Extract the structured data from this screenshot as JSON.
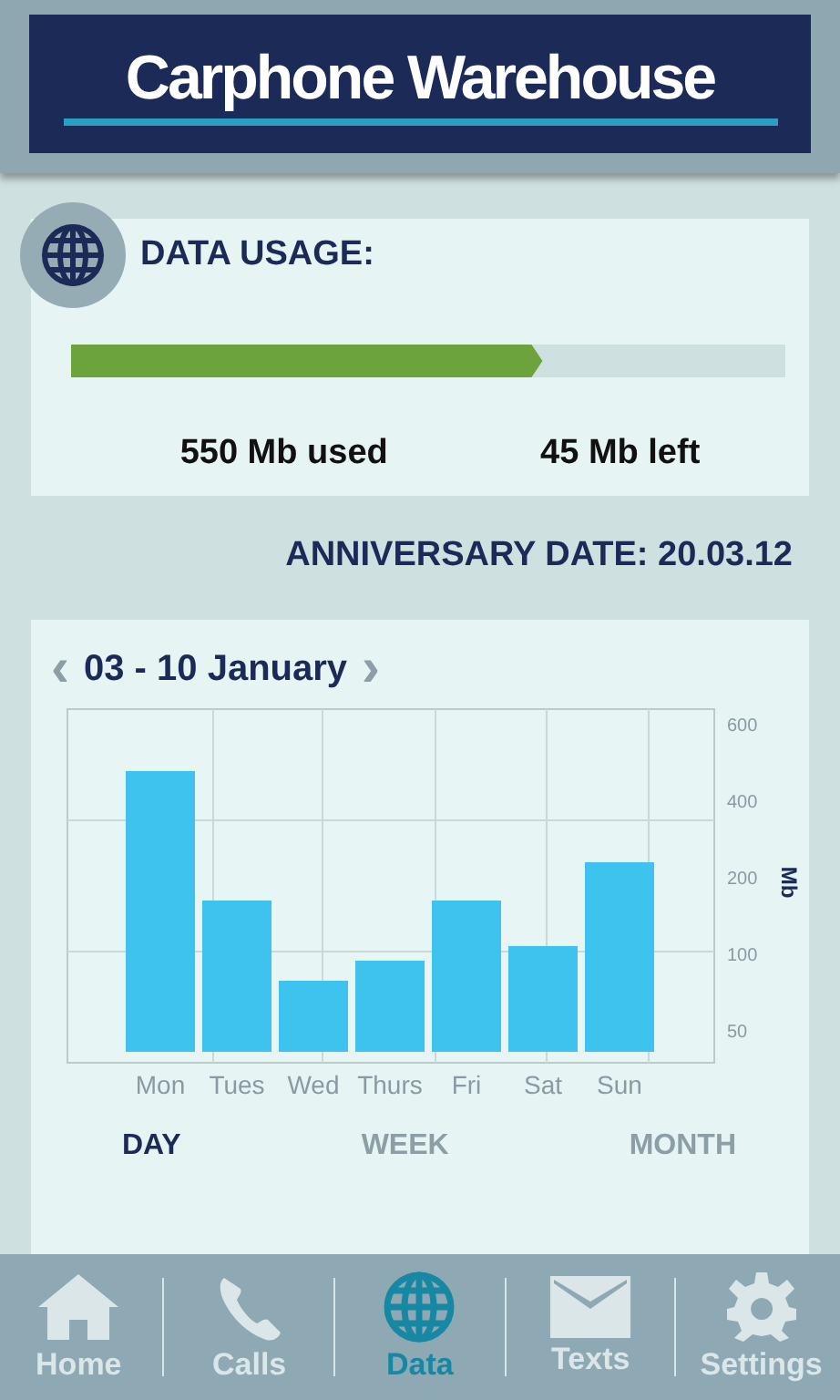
{
  "header": {
    "logo": "Carphone Warehouse"
  },
  "data_usage": {
    "title": "DATA USAGE:",
    "level": 0.66,
    "used": "550 Mb used",
    "left": "45 Mb left"
  },
  "anniversary": "ANNIVERSARY DATE: 20.03.12",
  "usage_chart": {
    "range": "03 - 10 January",
    "prev": "‹",
    "next": "›",
    "day_labels": [
      "Mon",
      "Tues",
      "Wed",
      "Thurs",
      "Fri",
      "Sat",
      "Sun"
    ],
    "axis_labels": [
      "600",
      "400",
      "200",
      "100",
      "50"
    ],
    "unit": "Mb",
    "periods": [
      {
        "label": "DAY",
        "selected": true
      },
      {
        "label": "WEEK",
        "selected": false
      },
      {
        "label": "MONTH",
        "selected": false
      }
    ]
  },
  "nav": [
    {
      "label": "Home",
      "selected": false
    },
    {
      "label": "Calls",
      "selected": false
    },
    {
      "label": "Data",
      "selected": true
    },
    {
      "label": "Texts",
      "selected": false
    },
    {
      "label": "Settings",
      "selected": false
    }
  ]
}
